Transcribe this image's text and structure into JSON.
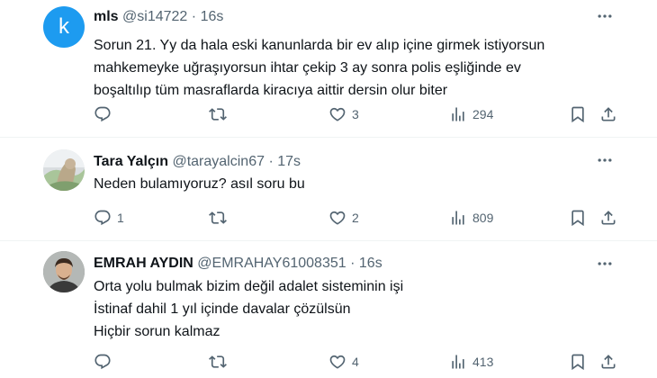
{
  "tweets": [
    {
      "avatar_letter": "k",
      "name": "mls",
      "handle": "@si14722",
      "separator": "·",
      "time": "16s",
      "lines": [
        "Sorun 21. Yy da hala eski kanunlarda bir ev alıp içine girmek istiyorsun",
        "mahkemeyke uğraşıyorsun  ihtar çekip 3 ay sonra polis eşliğinde ev",
        "boşaltılıp tüm masraflarda kiracıya aittir dersin olur biter"
      ],
      "replies": "",
      "retweets": "",
      "likes": "3",
      "views": "294"
    },
    {
      "name": "Tara Yalçın",
      "handle": "@tarayalcin67",
      "separator": "·",
      "time": "17s",
      "lines": [
        "Neden bulamıyoruz? asıl soru bu"
      ],
      "replies": "1",
      "retweets": "",
      "likes": "2",
      "views": "809"
    },
    {
      "name": "EMRAH AYDIN",
      "handle": "@EMRAHAY61008351",
      "separator": "·",
      "time": "16s",
      "lines": [
        "Orta yolu bulmak bizim değil adalet sisteminin işi",
        "İstinaf dahil 1 yıl içinde davalar çözülsün",
        "Hiçbir sorun kalmaz"
      ],
      "replies": "",
      "retweets": "",
      "likes": "4",
      "views": "413"
    }
  ],
  "icons": {
    "reply": "reply-icon",
    "retweet": "retweet-icon",
    "like": "heart-icon",
    "views": "views-icon",
    "bookmark": "bookmark-icon",
    "share": "share-icon",
    "more": "more-icon"
  },
  "colors": {
    "text": "#0f1419",
    "secondary": "#536471",
    "divider": "#eff3f4",
    "avatar_k": "#1d9bf0"
  }
}
